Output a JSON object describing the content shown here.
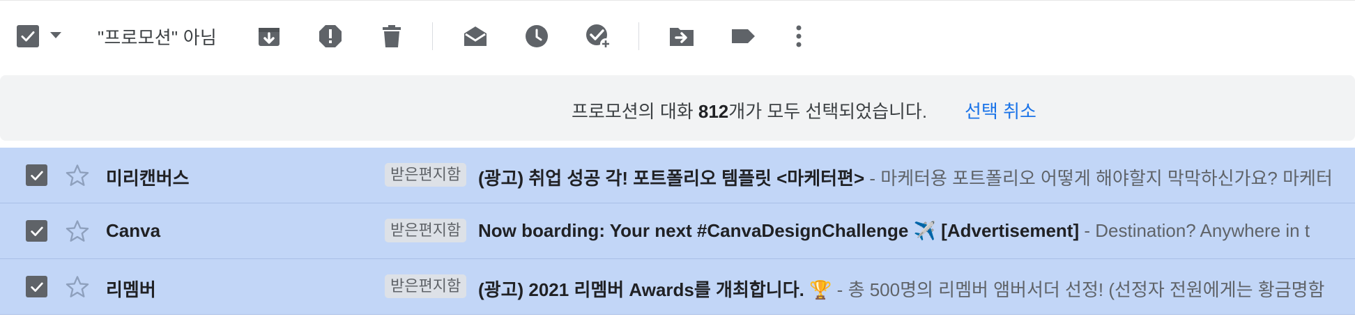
{
  "toolbar": {
    "filter_label": "\"프로모션\" 아님",
    "icons": [
      "checkbox-icon",
      "chevron-down-icon",
      "archive-icon",
      "report-spam-icon",
      "delete-icon",
      "mark-as-read-icon",
      "snooze-icon",
      "add-to-tasks-icon",
      "move-to-icon",
      "label-icon",
      "more-options-icon"
    ]
  },
  "banner": {
    "text_before": "프로모션의 대화 ",
    "count": "812",
    "text_after": "개가 모두 선택되었습니다.",
    "clear_selection": "선택 취소"
  },
  "rows": [
    {
      "sender": "미리캔버스",
      "label": "받은편지함",
      "subject": "(광고) 취업 성공 각! 포트폴리오 템플릿 <마케터편>",
      "separator": " - ",
      "snippet": "마케터용 포트폴리오 어떻게 해야할지 막막하신가요? 마케터",
      "selected": true,
      "starred": false
    },
    {
      "sender": "Canva",
      "label": "받은편지함",
      "subject": "Now boarding: Your next #CanvaDesignChallenge ✈️ [Advertisement]",
      "separator": " - ",
      "snippet": "Destination? Anywhere in t",
      "selected": true,
      "starred": false
    },
    {
      "sender": "리멤버",
      "label": "받은편지함",
      "subject": "(광고) 2021 리멤버 Awards를 개최합니다. 🏆",
      "separator": " - ",
      "snippet": "총 500명의 리멤버 앰버서더 선정! (선정자 전원에게는 황금명함",
      "selected": true,
      "starred": false
    }
  ],
  "colors": {
    "selected_row_bg": "#c2d6f7",
    "link_blue": "#1a73e8",
    "icon_gray": "#5f6368",
    "banner_bg": "#f2f3f4"
  }
}
